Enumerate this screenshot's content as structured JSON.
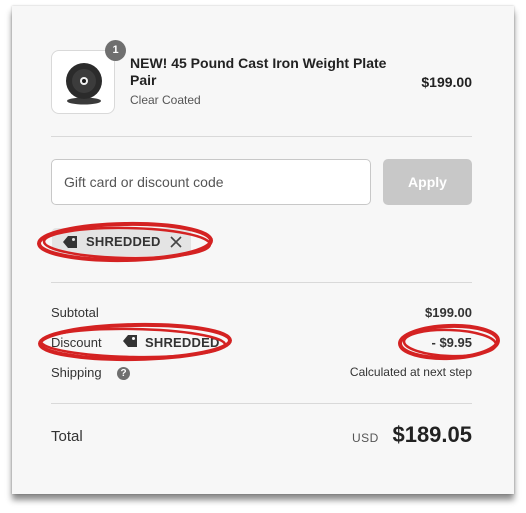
{
  "line_item": {
    "quantity": "1",
    "title": "NEW! 45 Pound Cast Iron Weight Plate Pair",
    "variant": "Clear Coated",
    "price": "$199.00"
  },
  "discount_form": {
    "placeholder": "Gift card or discount code",
    "apply_label": "Apply"
  },
  "applied_code": {
    "code": "SHREDDED"
  },
  "summary": {
    "subtotal_label": "Subtotal",
    "subtotal_value": "$199.00",
    "discount_label": "Discount",
    "discount_code": "SHREDDED",
    "discount_value": "- $9.95",
    "shipping_label": "Shipping",
    "shipping_value": "Calculated at next step",
    "total_label": "Total",
    "currency": "USD",
    "total_value": "$189.05"
  },
  "colors": {
    "annotation": "#d42222",
    "apply_disabled": "#c8c8c8",
    "chip_bg": "#e4e4e4"
  }
}
